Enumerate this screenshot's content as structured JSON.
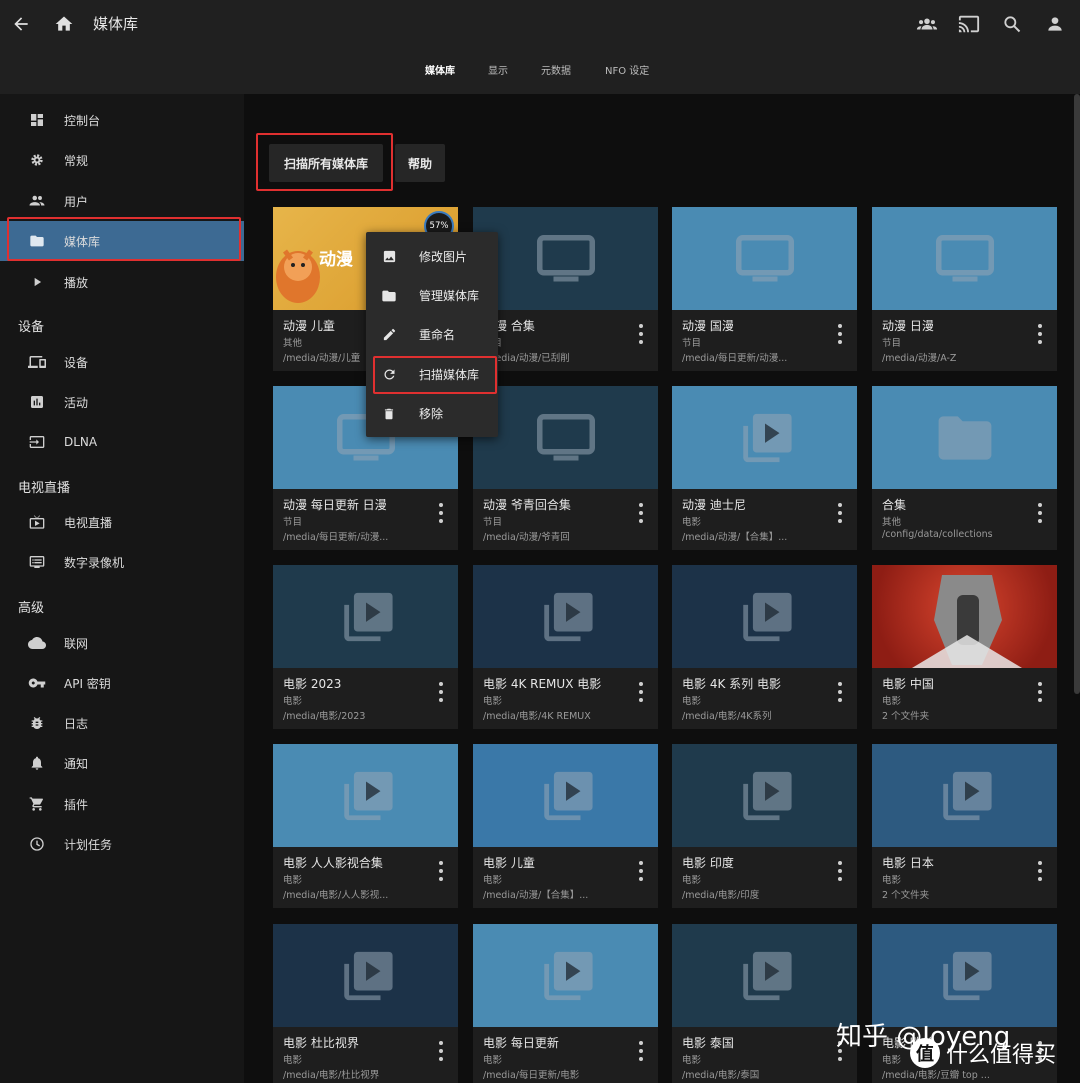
{
  "header": {
    "title": "媒体库",
    "icons": [
      "back-arrow-icon",
      "home-icon",
      "users-icon",
      "cast-icon",
      "search-icon",
      "account-icon"
    ]
  },
  "tabs": [
    {
      "label": "媒体库",
      "active": true
    },
    {
      "label": "显示",
      "active": false
    },
    {
      "label": "元数据",
      "active": false
    },
    {
      "label": "NFO 设定",
      "active": false
    }
  ],
  "sidebar": {
    "items": [
      {
        "label": "控制台",
        "icon": "dashboard-icon"
      },
      {
        "label": "常规",
        "icon": "gear-icon"
      },
      {
        "label": "用户",
        "icon": "users-icon"
      },
      {
        "label": "媒体库",
        "icon": "folder-icon",
        "active": true
      },
      {
        "label": "播放",
        "icon": "play-icon"
      }
    ],
    "section_devices": "设备",
    "devices_items": [
      {
        "label": "设备",
        "icon": "devices-icon"
      },
      {
        "label": "活动",
        "icon": "activity-icon"
      },
      {
        "label": "DLNA",
        "icon": "input-icon"
      }
    ],
    "section_live": "电视直播",
    "live_items": [
      {
        "label": "电视直播",
        "icon": "live-tv-icon"
      },
      {
        "label": "数字录像机",
        "icon": "dvr-icon"
      }
    ],
    "section_advanced": "高级",
    "advanced_items": [
      {
        "label": "联网",
        "icon": "cloud-icon"
      },
      {
        "label": "API 密钥",
        "icon": "key-icon"
      },
      {
        "label": "日志",
        "icon": "bug-icon"
      },
      {
        "label": "通知",
        "icon": "bell-icon"
      },
      {
        "label": "插件",
        "icon": "cart-icon"
      },
      {
        "label": "计划任务",
        "icon": "clock-icon"
      }
    ]
  },
  "toolbar": {
    "scan_all_label": "扫描所有媒体库",
    "help_label": "帮助"
  },
  "context_menu": {
    "items": [
      {
        "label": "修改图片",
        "icon": "image-icon"
      },
      {
        "label": "管理媒体库",
        "icon": "folder-icon"
      },
      {
        "label": "重命名",
        "icon": "pencil-icon"
      },
      {
        "label": "扫描媒体库",
        "icon": "refresh-icon"
      },
      {
        "label": "移除",
        "icon": "trash-icon"
      }
    ]
  },
  "progress_label": "57%",
  "libraries": [
    {
      "title": "动漫 儿童",
      "type": "其他",
      "path": "/media/动漫/儿童",
      "thumb": "cartoon",
      "color": "#d9a030"
    },
    {
      "title": "动漫 合集",
      "type": "节目",
      "path": "/media/动漫/已刮削",
      "thumb": "tv",
      "color": "#1f3a4c"
    },
    {
      "title": "动漫 国漫",
      "type": "节目",
      "path": "/media/每日更新/动漫...",
      "thumb": "tv",
      "color": "#4a8bb3"
    },
    {
      "title": "动漫 日漫",
      "type": "节目",
      "path": "/media/动漫/A-Z",
      "thumb": "tv",
      "color": "#4a8bb3"
    },
    {
      "title": "动漫 每日更新 日漫",
      "type": "节目",
      "path": "/media/每日更新/动漫...",
      "thumb": "tv",
      "color": "#4a8bb3"
    },
    {
      "title": "动漫 爷青回合集",
      "type": "节目",
      "path": "/media/动漫/爷青回",
      "thumb": "tv",
      "color": "#1f3a4c"
    },
    {
      "title": "动漫 迪士尼",
      "type": "电影",
      "path": "/media/动漫/【合集】...",
      "thumb": "movie",
      "color": "#4a8bb3"
    },
    {
      "title": "合集",
      "type": "其他",
      "path": "/config/data/collections",
      "thumb": "folder",
      "color": "#4a8bb3"
    },
    {
      "title": "电影 2023",
      "type": "电影",
      "path": "/media/电影/2023",
      "thumb": "movie",
      "color": "#1f3a4c"
    },
    {
      "title": "电影 4K REMUX 电影",
      "type": "电影",
      "path": "/media/电影/4K REMUX",
      "thumb": "movie",
      "color": "#1c3248"
    },
    {
      "title": "电影 4K 系列 电影",
      "type": "电影",
      "path": "/media/电影/4K系列",
      "thumb": "movie",
      "color": "#1c3248"
    },
    {
      "title": "电影 中国",
      "type": "电影",
      "path": "2 个文件夹",
      "thumb": "voice",
      "color": "#b02a1e"
    },
    {
      "title": "电影 人人影视合集",
      "type": "电影",
      "path": "/media/电影/人人影视...",
      "thumb": "movie",
      "color": "#4a8bb3"
    },
    {
      "title": "电影 儿童",
      "type": "电影",
      "path": "/media/动漫/【合集】...",
      "thumb": "movie",
      "color": "#3a78a8"
    },
    {
      "title": "电影 印度",
      "type": "电影",
      "path": "/media/电影/印度",
      "thumb": "movie",
      "color": "#1f3a4c"
    },
    {
      "title": "电影 日本",
      "type": "电影",
      "path": "2 个文件夹",
      "thumb": "movie",
      "color": "#2d5a80"
    },
    {
      "title": "电影 杜比视界",
      "type": "电影",
      "path": "/media/电影/杜比视界",
      "thumb": "movie",
      "color": "#1c3248"
    },
    {
      "title": "电影 每日更新",
      "type": "电影",
      "path": "/media/每日更新/电影",
      "thumb": "movie",
      "color": "#4a8bb3"
    },
    {
      "title": "电影 泰国",
      "type": "电影",
      "path": "/media/电影/泰国",
      "thumb": "movie",
      "color": "#1f3a4c"
    },
    {
      "title": "电影 欧美",
      "type": "电影",
      "path": "/media/电影/豆瓣 top ...",
      "thumb": "movie",
      "color": "#2d5a80"
    }
  ],
  "watermark": "知乎 @Joyeng",
  "watermark2": "什么值得买",
  "watermark2_badge": "值"
}
